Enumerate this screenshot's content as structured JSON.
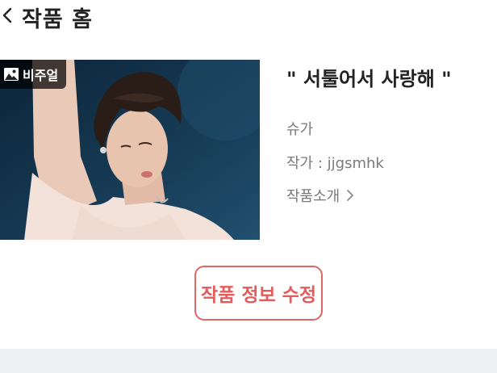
{
  "header": {
    "title": "작품 홈",
    "back_icon": "chevron-left-icon"
  },
  "cover": {
    "badge_label": "비주얼",
    "badge_icon": "image-icon"
  },
  "work": {
    "title": "\" 서툴어서 사랑해 \"",
    "character": "슈가",
    "author_prefix": "작가 : ",
    "author_name": "jjgsmhk",
    "intro_label": "작품소개",
    "intro_icon": "chevron-right-icon"
  },
  "actions": {
    "edit_label": "작품 정보 수정"
  },
  "colors": {
    "accent": "#e55a5a",
    "muted_text": "#7a7a7a",
    "bottom_bar": "#eef1f3"
  }
}
